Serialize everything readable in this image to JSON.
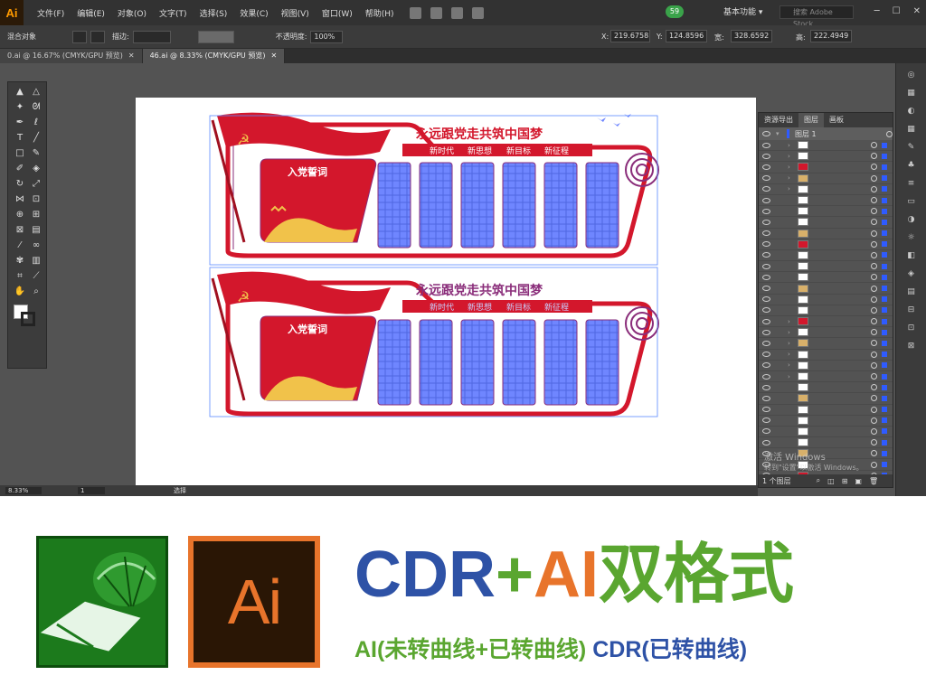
{
  "app": {
    "logo": "Ai",
    "menus": [
      "文件(F)",
      "编辑(E)",
      "对象(O)",
      "文字(T)",
      "选择(S)",
      "效果(C)",
      "视图(V)",
      "窗口(W)",
      "帮助(H)"
    ],
    "badge": "59",
    "workspace": "基本功能",
    "search_placeholder": "搜索 Adobe Stock"
  },
  "control_bar": {
    "object_type": "混合对象",
    "stroke_label": "描边:",
    "opacity_label": "不透明度:",
    "opacity_value": "100%",
    "x_label": "X:",
    "x_value": "219.6758",
    "y_label": "Y:",
    "y_value": "124.8596",
    "w_label": "宽:",
    "w_value": "328.6592",
    "h_label": "高:",
    "h_value": "222.4949"
  },
  "tabs": [
    {
      "label": "0.ai @ 16.67% (CMYK/GPU 预览)",
      "active": false
    },
    {
      "label": "46.ai @ 8.33% (CMYK/GPU 预览)",
      "active": true
    }
  ],
  "design": {
    "slogan": "永远跟党走共筑中国梦",
    "subtitle_items": [
      "新时代",
      "新思想",
      "新目标",
      "新征程"
    ],
    "oath_title": "入党誓词",
    "colors": {
      "red": "#d3172c",
      "gold": "#f1c24a",
      "blue_panel": "#6f86ff",
      "purple_outline": "#8a2d7a"
    }
  },
  "layers_panel": {
    "tabs": [
      "资源导出",
      "图层",
      "画板"
    ],
    "layer_name": "图层 1",
    "footer": "1 个图层"
  },
  "status_bar": {
    "zoom": "8.33%",
    "page": "1",
    "status_text": "选择"
  },
  "windows_activate": {
    "line1": "激活 Windows",
    "line2": "转到\"设置\"以激活 Windows。"
  },
  "promo": {
    "cdr_text": "CDR",
    "plus": "+",
    "ai_text": "AI",
    "format_text": "双格式",
    "ai_icon_text": "Ai",
    "sub_ai": "AI(未转曲线+已转曲线)",
    "sub_cdr": "CDR(已转曲线)"
  }
}
